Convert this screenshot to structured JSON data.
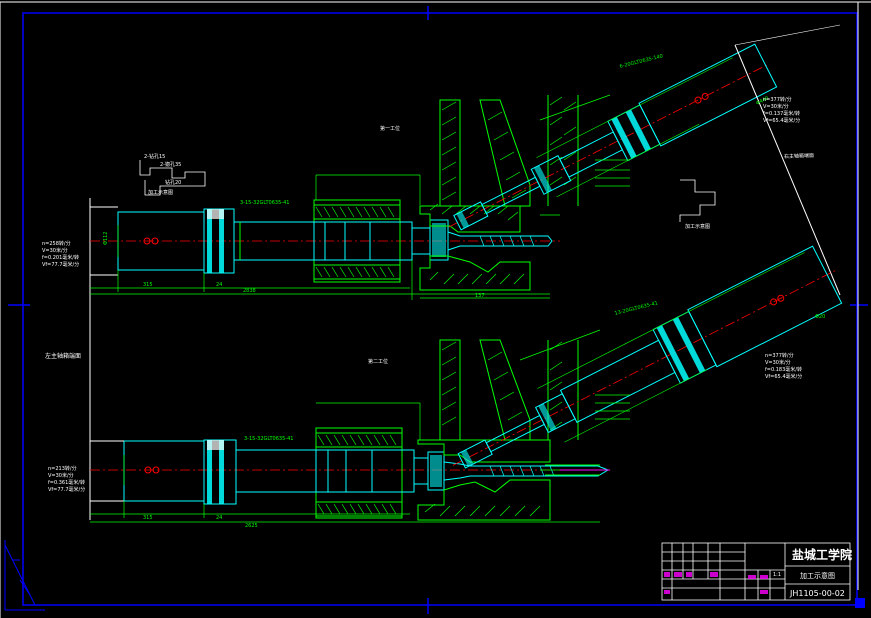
{
  "drawing": {
    "school_name": "盐城工学院",
    "drawing_name": "加工示意图",
    "drawing_number": "JH1105-00-02",
    "sheet": "1:1"
  },
  "stations": {
    "first": "第一工位",
    "second": "第二工位"
  },
  "labels": {
    "left_end": "左主轴箱端面",
    "right_end": "右主轴箱端面",
    "spec_left_top": "3-15-32GLT0635-41",
    "spec_left_bottom": "3-15-32GLT0635-41",
    "spec_right_top": "6-20GLT0635-140",
    "spec_right_bottom": "13-20GLT0635-41",
    "right_note": "加工示意图",
    "left_small_1": "2-钻孔15",
    "left_small_2": "2-锪孔35",
    "left_small_3": "钻孔20",
    "left_small_4": "加工示意图"
  },
  "dimensions": {
    "d315_top": "315",
    "d24_top": "24",
    "d2838": "2838",
    "d137": "137",
    "d315_bottom": "315",
    "d24_bottom": "24",
    "d2625": "2625",
    "d440": "Φ440",
    "d20": "Φ20",
    "d112": "Φ112"
  },
  "cutting_params": {
    "left_top": [
      "n=258转/分",
      "V=30米/分",
      "f=0.201毫米/转",
      "Vf=77.7毫米/分"
    ],
    "left_bottom": [
      "n=213转/分",
      "V=30米/分",
      "f=0.361毫米/转",
      "Vf=77.7毫米/分"
    ],
    "right_top": [
      "n=377转/分",
      "V=30米/分",
      "f=0.137毫米/转",
      "Vf=65.4毫米/分"
    ],
    "right_bottom": [
      "n=377转/分",
      "V=30米/分",
      "f=0.183毫米/转",
      "Vf=65.4毫米/分"
    ]
  },
  "colors": {
    "background": "#000000",
    "frame": "#0000ff",
    "outline": "#00ffff",
    "dimension": "#00ff00",
    "text": "#ffffff",
    "centerline": "#ff0000",
    "hatch": "#00ff00",
    "accent": "#ff00ff"
  }
}
